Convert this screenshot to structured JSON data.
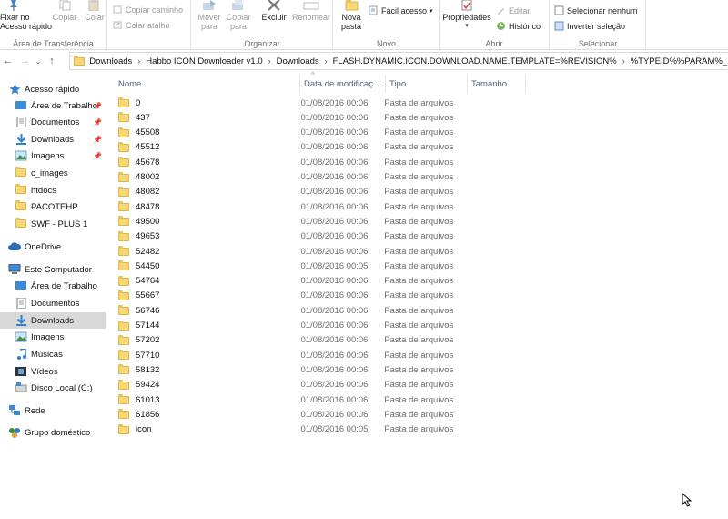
{
  "ribbon": {
    "groups": {
      "clipboard": "Área de Transferência",
      "organize": "Organizar",
      "new": "Novo",
      "open": "Abrir",
      "select": "Selecionar"
    },
    "pin_quick_access": "Fixar no\nAcesso rápido",
    "copy": "Copiar",
    "paste": "Colar",
    "copy_path": "Copiar caminho",
    "paste_shortcut": "Colar atalho",
    "move_to": "Mover\npara",
    "copy_to": "Copiar\npara",
    "delete": "Excluir",
    "rename": "Renomear",
    "new_folder": "Nova\npasta",
    "easy_access": "Fácil acesso",
    "properties": "Propriedades",
    "edit": "Editar",
    "history": "Histórico",
    "select_none": "Selecionar nenhum",
    "invert_selection": "Inverter seleção"
  },
  "address": {
    "overflow": "«",
    "crumbs": [
      "Downloads",
      "Habbo ICON Downloader v1.0",
      "Downloads",
      "FLASH.DYNAMIC.ICON.DOWNLOAD.NAME.TEMPLATE=%REVISION%",
      "%TYPEID%%PARAM%_ICON."
    ]
  },
  "nav": {
    "quick_access": "Acesso rápido",
    "desktop": "Área de Trabalho",
    "documents": "Documentos",
    "downloads": "Downloads",
    "images": "Imagens",
    "c_images": "c_images",
    "htdocs": "htdocs",
    "pacotehp": "PACOTEHP",
    "swf_plus": "SWF - PLUS 1",
    "onedrive": "OneDrive",
    "this_pc": "Este Computador",
    "pc_desktop": "Área de Trabalho",
    "pc_documents": "Documentos",
    "pc_downloads": "Downloads",
    "pc_images": "Imagens",
    "music": "Músicas",
    "videos": "Vídeos",
    "local_disk": "Disco Local (C:)",
    "network": "Rede",
    "homegroup": "Grupo doméstico"
  },
  "columns": {
    "name": "Nome",
    "date": "Data de modificaç...",
    "type": "Tipo",
    "size": "Tamanho"
  },
  "files": [
    {
      "name": "0",
      "date": "01/08/2016 00:06",
      "type": "Pasta de arquivos"
    },
    {
      "name": "437",
      "date": "01/08/2016 00:06",
      "type": "Pasta de arquivos"
    },
    {
      "name": "45508",
      "date": "01/08/2016 00:06",
      "type": "Pasta de arquivos"
    },
    {
      "name": "45512",
      "date": "01/08/2016 00:06",
      "type": "Pasta de arquivos"
    },
    {
      "name": "45678",
      "date": "01/08/2016 00:06",
      "type": "Pasta de arquivos"
    },
    {
      "name": "48002",
      "date": "01/08/2016 00:06",
      "type": "Pasta de arquivos"
    },
    {
      "name": "48082",
      "date": "01/08/2016 00:06",
      "type": "Pasta de arquivos"
    },
    {
      "name": "48478",
      "date": "01/08/2016 00:06",
      "type": "Pasta de arquivos"
    },
    {
      "name": "49500",
      "date": "01/08/2016 00:06",
      "type": "Pasta de arquivos"
    },
    {
      "name": "49653",
      "date": "01/08/2016 00:06",
      "type": "Pasta de arquivos"
    },
    {
      "name": "52482",
      "date": "01/08/2016 00:06",
      "type": "Pasta de arquivos"
    },
    {
      "name": "54450",
      "date": "01/08/2016 00:05",
      "type": "Pasta de arquivos"
    },
    {
      "name": "54764",
      "date": "01/08/2016 00:06",
      "type": "Pasta de arquivos"
    },
    {
      "name": "55667",
      "date": "01/08/2016 00:06",
      "type": "Pasta de arquivos"
    },
    {
      "name": "56746",
      "date": "01/08/2016 00:06",
      "type": "Pasta de arquivos"
    },
    {
      "name": "57144",
      "date": "01/08/2016 00:06",
      "type": "Pasta de arquivos"
    },
    {
      "name": "57202",
      "date": "01/08/2016 00:06",
      "type": "Pasta de arquivos"
    },
    {
      "name": "57710",
      "date": "01/08/2016 00:06",
      "type": "Pasta de arquivos"
    },
    {
      "name": "58132",
      "date": "01/08/2016 00:06",
      "type": "Pasta de arquivos"
    },
    {
      "name": "59424",
      "date": "01/08/2016 00:06",
      "type": "Pasta de arquivos"
    },
    {
      "name": "61013",
      "date": "01/08/2016 00:06",
      "type": "Pasta de arquivos"
    },
    {
      "name": "61856",
      "date": "01/08/2016 00:06",
      "type": "Pasta de arquivos"
    },
    {
      "name": "icon",
      "date": "01/08/2016 00:05",
      "type": "Pasta de arquivos"
    }
  ],
  "icons": {
    "pin": "pin-icon",
    "folder": "folder-icon",
    "back": "back-arrow-icon",
    "forward": "forward-arrow-icon",
    "up": "up-arrow-icon"
  },
  "colors": {
    "selected_bg": "#d9d9d9",
    "header_text": "#4c607a",
    "folder_yellow": "#f8d775"
  }
}
